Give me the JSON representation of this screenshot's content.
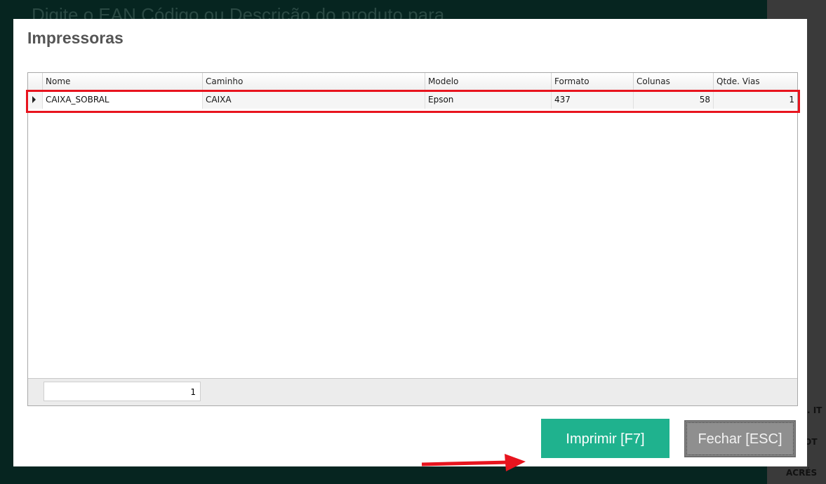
{
  "background": {
    "search_hint": "Digite o EAN Código ou Descrição do produto para",
    "right_labels": [
      "D. IT",
      "TOT",
      "ACRÉS"
    ]
  },
  "dialog": {
    "title": "Impressoras",
    "grid": {
      "columns": [
        "Nome",
        "Caminho",
        "Modelo",
        "Formato",
        "Colunas",
        "Qtde. Vias"
      ],
      "rows": [
        {
          "nome": "CAIXA_SOBRAL",
          "caminho": "CAIXA",
          "modelo": "Epson",
          "formato": "437",
          "colunas": "58",
          "vias": "1"
        }
      ],
      "footer_count": "1"
    },
    "buttons": {
      "print": "Imprimir [F7]",
      "close": "Fechar [ESC]"
    }
  },
  "colors": {
    "print_button": "#1fb28e",
    "highlight": "#e8141e",
    "backdrop": "#062520"
  }
}
